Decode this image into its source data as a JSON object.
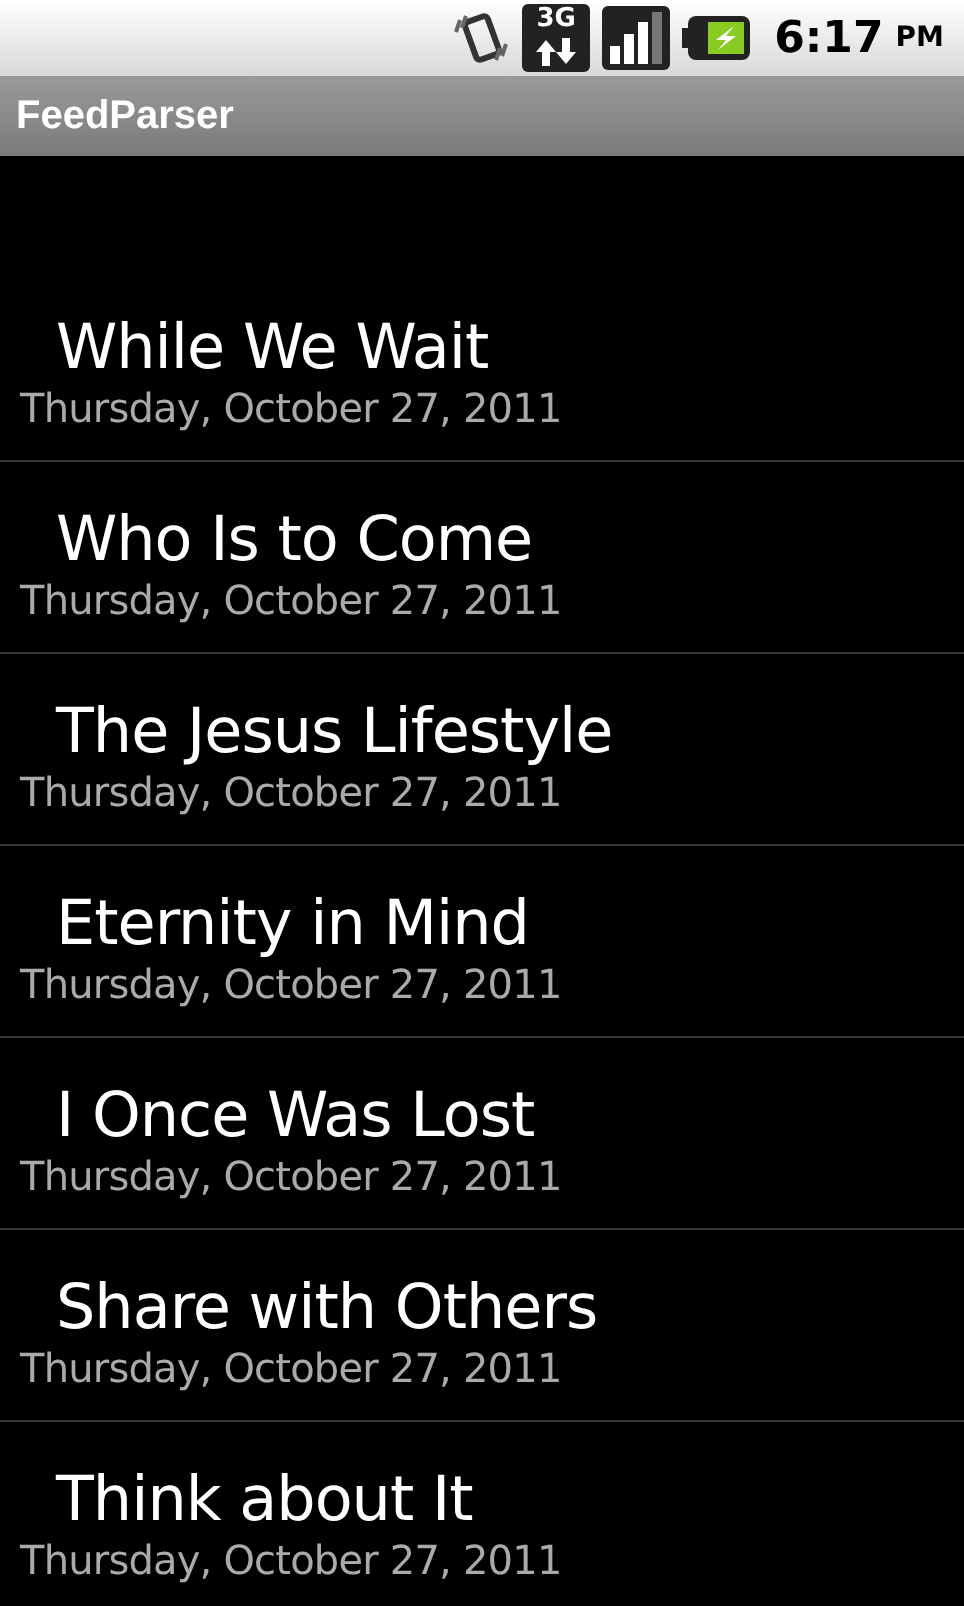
{
  "status_bar": {
    "network": "3G",
    "time": "6:17",
    "ampm": "PM"
  },
  "title_bar": {
    "title": "FeedParser"
  },
  "feed_items": [
    {
      "title": "While We Wait",
      "date": "Thursday, October 27, 2011"
    },
    {
      "title": "Who Is to Come",
      "date": "Thursday, October 27, 2011"
    },
    {
      "title": "The Jesus Lifestyle",
      "date": "Thursday, October 27, 2011"
    },
    {
      "title": "Eternity in Mind",
      "date": "Thursday, October 27, 2011"
    },
    {
      "title": "I Once Was Lost",
      "date": "Thursday, October 27, 2011"
    },
    {
      "title": "Share with Others",
      "date": "Thursday, October 27, 2011"
    },
    {
      "title": "Think about It",
      "date": "Thursday, October 27, 2011"
    }
  ]
}
